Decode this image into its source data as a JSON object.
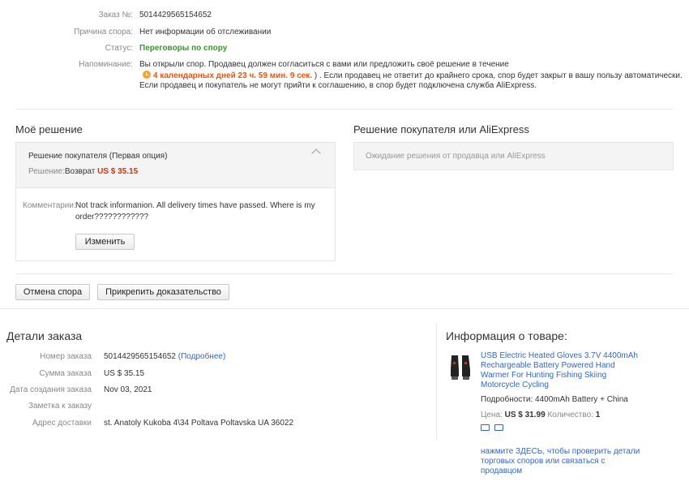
{
  "dispute": {
    "order_label": "Заказ №:",
    "order_value": "5014429565154652",
    "reason_label": "Причина спора:",
    "reason_value": "Нет информации об отслеживании",
    "status_label": "Статус:",
    "status_value": "Переговоры по спору",
    "reminder_label": "Напоминание:",
    "reminder_line1": "Вы открыли спор. Продавец должен согласиться с вами или предложить своё решение в течение",
    "reminder_countdown": "4 календарных дней 23 ч. 59 мин. 9 сек.",
    "reminder_line2_rest": " ) . Если продавец не ответит до крайнего срока, спор будет закрыт в вашу пользу автоматически.",
    "reminder_line3": "Если продавец и покупатель не могут прийти к соглашению, в спор будет подключена служба AliExpress."
  },
  "my_solution": {
    "title": "Моё решение",
    "option_title": "Решение покупателя (Первая опция)",
    "decision_label": "Решение:",
    "decision_value": "Возврат",
    "decision_amount": "US $ 35.15",
    "comment_label": "Комментарии:",
    "comment_line1": "Not track informanion. All delivery times have passed. Where is my",
    "comment_line2": "order????????????",
    "edit_button": "Изменить"
  },
  "buyer_solution": {
    "title": "Решение покупателя или AliExpress",
    "waiting": "Ожидание решения от продавца или AliExpress"
  },
  "actions": {
    "cancel_dispute": "Отмена спора",
    "attach_evidence": "Прикрепить доказательство"
  },
  "order_details": {
    "title": "Детали заказа",
    "number_label": "Номер заказа",
    "number_value": "5014429565154652",
    "more_link": "(Подробнее)",
    "amount_label": "Сумма заказа",
    "amount_value": "US $ 35.15",
    "created_label": "Дата создания заказа",
    "created_value": "Nov 03, 2021",
    "note_label": "Заметка к заказу",
    "note_value": "",
    "address_label": "Адрес доставки",
    "address_value": "st. Anatoly Kukoba 4\\34 Poltava Poltavska UA 36022"
  },
  "product": {
    "title": "Информация о товаре:",
    "name_line1": "USB Electric Heated Gloves 3.7V 4400mAh",
    "name_line2": "Rechargeable Battery Powered Hand",
    "name_line3": "Warmer For Hunting Fishing Skiing",
    "name_line4": "Motorcycle Cycling",
    "details_label": "Подробности:",
    "details_value": "4400mAh Battery + China",
    "price_label": "Цена:",
    "price_value": "US $ 31.99",
    "qty_label": "Количество:",
    "qty_value": "1",
    "help_line1": "нажмите ЗДЕСЬ, чтобы проверить детали",
    "help_line2": "торговых споров или связаться с",
    "help_line3": "продавцом"
  }
}
